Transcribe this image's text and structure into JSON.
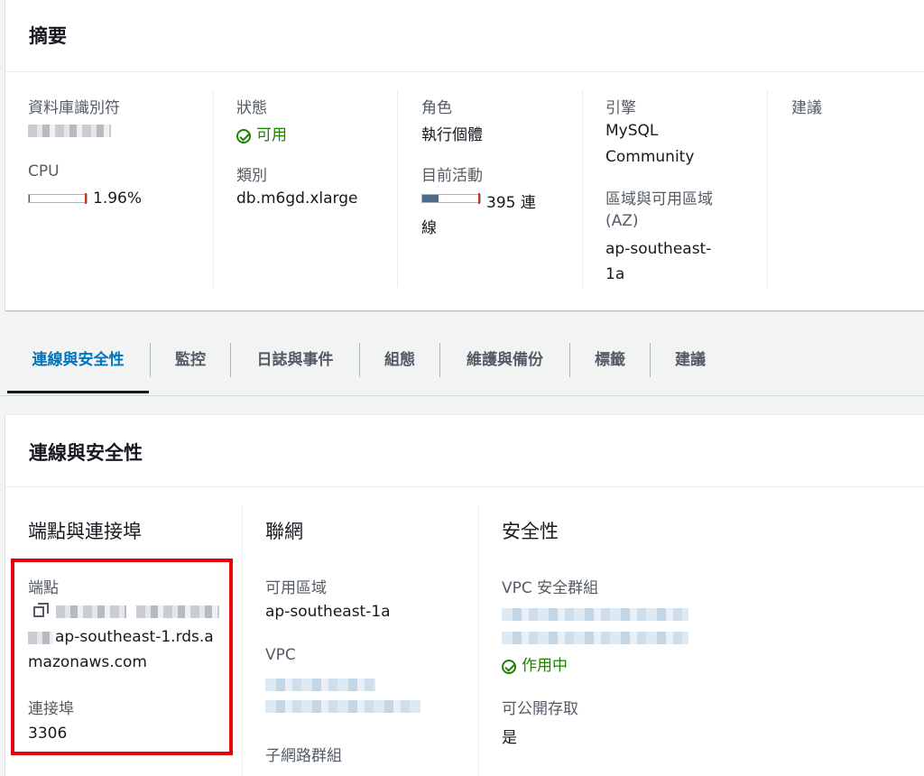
{
  "summary": {
    "title": "摘要",
    "db_identifier_label": "資料庫識別符",
    "cpu_label": "CPU",
    "cpu_value": "1.96%",
    "cpu_fraction": 0.0196,
    "status_label": "狀態",
    "status_value": "可用",
    "class_label": "類別",
    "class_value": "db.m6gd.xlarge",
    "role_label": "角色",
    "role_value": "執行個體",
    "activity_label": "目前活動",
    "activity_value": "395 連",
    "activity_value_wrap": "線",
    "engine_label": "引擎",
    "engine_value_line1": "MySQL",
    "engine_value_line2": "Community",
    "region_label_line1": "區域與可用區域",
    "region_label_line2": "(AZ)",
    "region_value_line1": "ap-southeast-",
    "region_value_line2": "1a",
    "recommend_label": "建議"
  },
  "tabs": [
    {
      "label": "連線與安全性",
      "active": true
    },
    {
      "label": "監控"
    },
    {
      "label": "日誌與事件"
    },
    {
      "label": "組態"
    },
    {
      "label": "維護與備份"
    },
    {
      "label": "標籤"
    },
    {
      "label": "建議"
    }
  ],
  "connectivity": {
    "title": "連線與安全性",
    "endpoint_section_title": "端點與連接埠",
    "endpoint_label": "端點",
    "endpoint_value_line2": "ap-southeast-1.rds.a",
    "endpoint_value_line3": "mazonaws.com",
    "port_label": "連接埠",
    "port_value": "3306",
    "network_section_title": "聯網",
    "az_label": "可用區域",
    "az_value": "ap-southeast-1a",
    "vpc_label": "VPC",
    "subnet_group_label": "子網路群組",
    "security_section_title": "安全性",
    "vpc_sg_label": "VPC 安全群組",
    "sg_status": "作用中",
    "public_access_label": "可公開存取",
    "public_access_value": "是"
  },
  "colors": {
    "accent": "#0073bb",
    "status_green": "#1d8102",
    "highlight_red": "#e6020c",
    "activity_fill": "#4a6b8a"
  },
  "activity_fraction": 0.28
}
